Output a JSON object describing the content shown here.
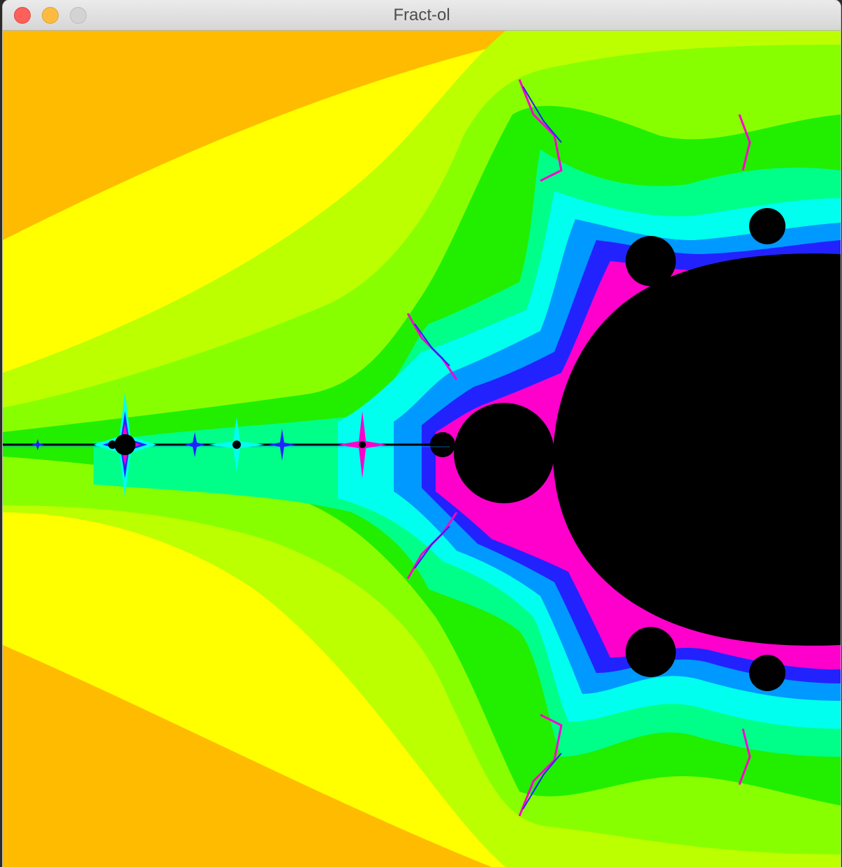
{
  "window": {
    "title": "Fract-ol"
  },
  "palette": {
    "outer": "#ffbb00",
    "band_yellow": "#ffff00",
    "band_lime": "#bbff00",
    "band_green_light": "#88ff00",
    "band_green": "#22ee00",
    "band_spring": "#00ff88",
    "band_cyan": "#00ffee",
    "band_azure": "#0099ff",
    "band_blue": "#2222ff",
    "band_violet": "#9900ff",
    "band_magenta": "#ff00cc",
    "interior": "#000000"
  }
}
